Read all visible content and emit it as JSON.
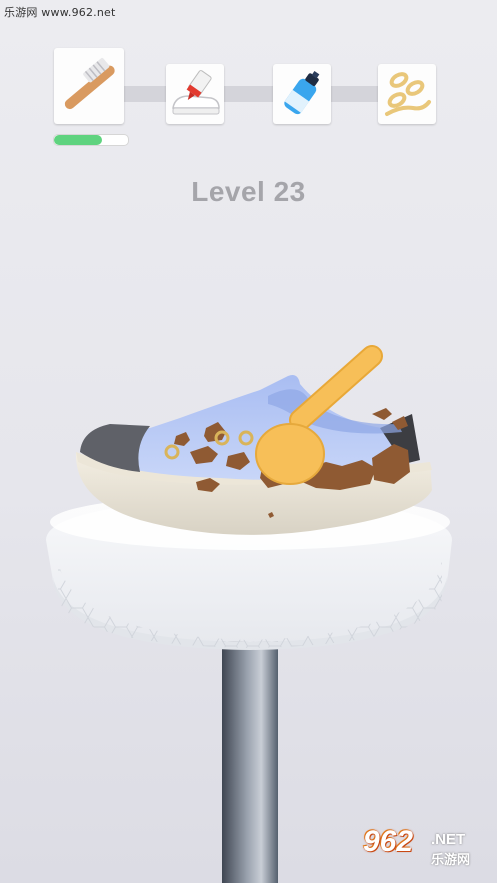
{
  "watermark": {
    "top_text": "乐游网 www.962.net",
    "logo_number": "962",
    "logo_suffix": ".NET",
    "logo_chinese": "乐游网"
  },
  "steps": [
    {
      "name": "toothbrush",
      "icon": "toothbrush-icon",
      "active": true
    },
    {
      "name": "glue",
      "icon": "glue-shoe-icon",
      "active": false
    },
    {
      "name": "bottle",
      "icon": "bottle-icon",
      "active": false
    },
    {
      "name": "laces",
      "icon": "laces-icon",
      "active": false
    }
  ],
  "progress": {
    "fraction": 0.65,
    "color": "#5fd37f"
  },
  "level": {
    "label": "Level 23"
  },
  "colors": {
    "background": "#e8e8ed",
    "shoe_upper": "#b7c9f4",
    "dirt": "#8f5a33",
    "tool": "#f7bf58",
    "stand_top": "#f6f7f9"
  }
}
